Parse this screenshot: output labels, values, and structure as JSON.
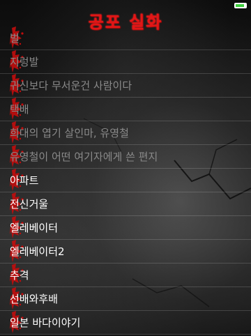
{
  "app": {
    "title": "공포 실화",
    "accent_color": "#e21616",
    "battery_color": "#3ecf3e",
    "battery_level": 0.85
  },
  "list": {
    "items": [
      {
        "label": "벌",
        "state": "faded"
      },
      {
        "label": "지렁발",
        "state": "faded"
      },
      {
        "label": "귀신보다 무서운건 사람이다",
        "state": "faded"
      },
      {
        "label": "택배",
        "state": "faded"
      },
      {
        "label": "희대의 엽기 살인마, 유영철",
        "state": "faded"
      },
      {
        "label": "유영철이 어떤 여기자에게 쓴 편지",
        "state": "faded"
      },
      {
        "label": "아파트",
        "state": "bright"
      },
      {
        "label": "전신거울",
        "state": "bright"
      },
      {
        "label": "엘레베이터",
        "state": "bright"
      },
      {
        "label": "엘레베이터2",
        "state": "bright"
      },
      {
        "label": "추격",
        "state": "bright"
      },
      {
        "label": "선배와후배",
        "state": "bright"
      },
      {
        "label": "일본 바다이야기",
        "state": "bright"
      }
    ]
  }
}
